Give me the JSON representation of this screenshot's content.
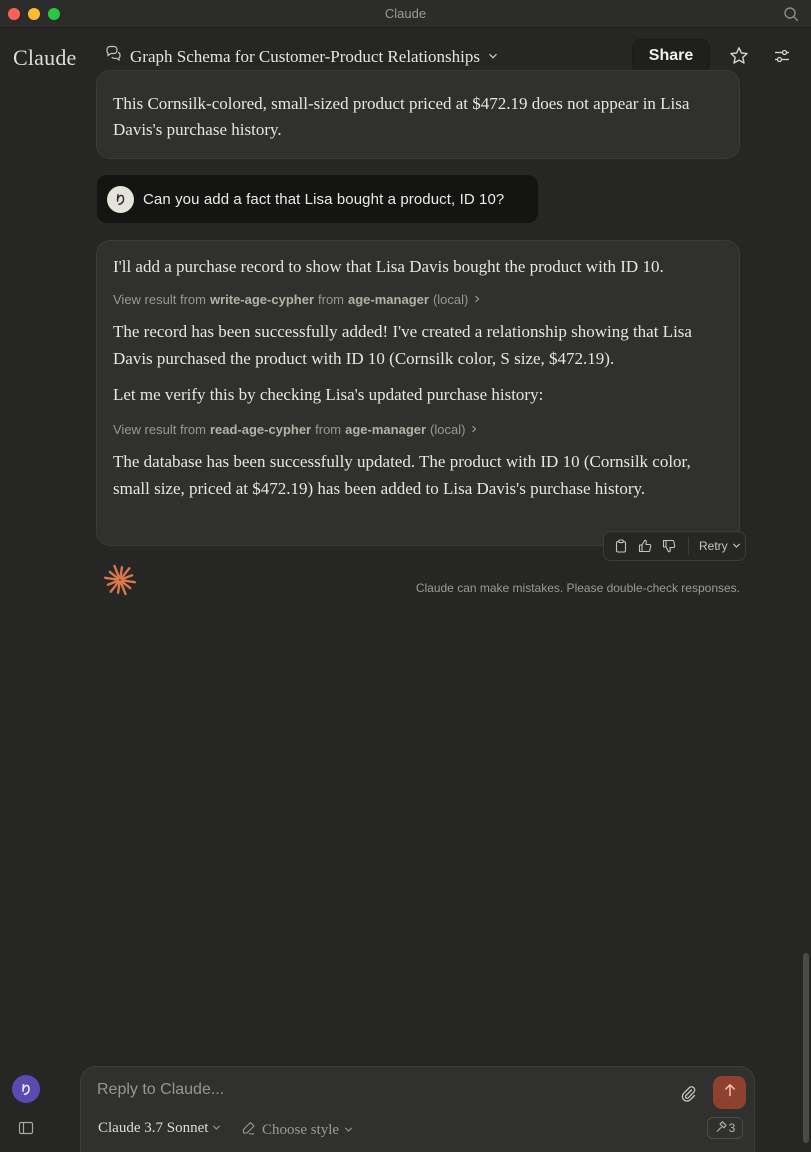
{
  "window": {
    "title": "Claude"
  },
  "header": {
    "brand": "Claude",
    "conversation_title": "Graph Schema for Customer-Product Relationships",
    "share_label": "Share"
  },
  "messages": {
    "previous_assistant_tail": "This Cornsilk-colored, small-sized product priced at $472.19 does not appear in Lisa Davis's purchase history.",
    "user": {
      "avatar_initial": "り",
      "text": "Can you add a fact that Lisa bought a product, ID 10?"
    },
    "assistant": {
      "p1": "I'll add a purchase record to show that Lisa Davis bought the product with ID 10.",
      "tool1": {
        "prefix": "View result from",
        "tool": "write-age-cypher",
        "from": "from",
        "server": "age-manager",
        "scope": "(local)"
      },
      "p2": "The record has been successfully added! I've created a relationship showing that Lisa Davis purchased the product with ID 10 (Cornsilk color, S size, $472.19).",
      "p3": "Let me verify this by checking Lisa's updated purchase history:",
      "tool2": {
        "prefix": "View result from",
        "tool": "read-age-cypher",
        "from": "from",
        "server": "age-manager",
        "scope": "(local)"
      },
      "p4": "The database has been successfully updated. The product with ID 10 (Cornsilk color, small size, priced at $472.19) has been added to Lisa Davis's purchase history."
    },
    "actions": {
      "retry_label": "Retry"
    },
    "disclaimer": "Claude can make mistakes. Please double-check responses."
  },
  "rail": {
    "avatar_initial": "り"
  },
  "composer": {
    "placeholder": "Reply to Claude...",
    "model": "Claude 3.7 Sonnet",
    "style": "Choose style",
    "tools_count": "3"
  },
  "colors": {
    "background": "#262624",
    "card": "#30302e",
    "user_bubble": "#141413",
    "accent_spark": "#d9774f",
    "send_button": "#8f4130",
    "avatar_purple": "#5b4ab0"
  }
}
